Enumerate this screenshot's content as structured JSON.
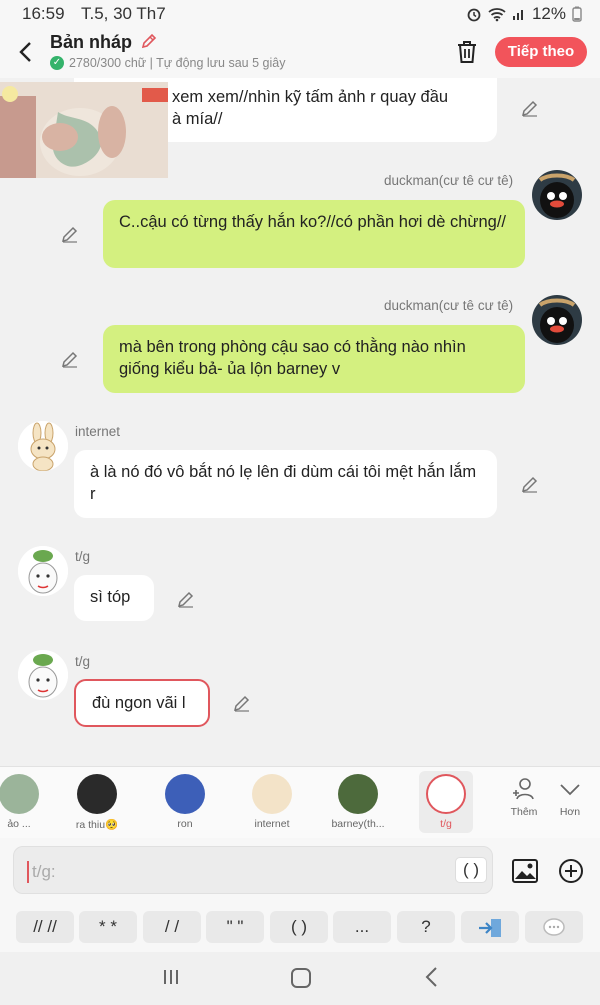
{
  "status": {
    "time": "16:59",
    "date": "T.5, 30 Th7",
    "battery": "12%"
  },
  "header": {
    "title": "Bản nháp",
    "subtitle": "2780/300 chữ | Tự động lưu sau 5 giây",
    "next_label": "Tiếp theo"
  },
  "messages": [
    {
      "speaker": "",
      "text": "xem xem//nhìn kỹ tấm ảnh r quay đầu\nà mía//",
      "style": "white",
      "side": "left"
    },
    {
      "speaker": "duckman(cư tê cư tê)",
      "text": "C..cậu có từng thấy hắn ko?//có phần hơi dè chừng//",
      "style": "green",
      "side": "right"
    },
    {
      "speaker": "duckman(cư tê cư tê)",
      "text": "mà bên trong phòng cậu sao có thằng nào nhìn giống kiểu bả- ủa lộn barney v",
      "style": "green",
      "side": "right"
    },
    {
      "speaker": "internet",
      "text": "à là nó đó vô bắt nó lẹ lên đi dùm cái tôi mệt hắn lắm r",
      "style": "white",
      "side": "left"
    },
    {
      "speaker": "t/g",
      "text": "sì tóp",
      "style": "white",
      "side": "left"
    },
    {
      "speaker": "t/g",
      "text": "đù ngon vãi l",
      "style": "outlined",
      "side": "left"
    }
  ],
  "characters": [
    {
      "label": "ảo ...",
      "color": "#9bb49a"
    },
    {
      "label": "ra thiu🥺",
      "color": "#2a2a2a"
    },
    {
      "label": "ron",
      "color": "#3d5fb8"
    },
    {
      "label": "internet",
      "color": "#f3e3c8"
    },
    {
      "label": "barney(th...",
      "color": "#4d6a3c"
    },
    {
      "label": "t/g",
      "color": "#ffffff"
    }
  ],
  "character_actions": {
    "add_label": "Thêm",
    "more_label": "Hơn"
  },
  "input": {
    "placeholder": "t/g:",
    "paren_label": "( )"
  },
  "quick_inserts": [
    "// //",
    "* *",
    "/ /",
    "\" \"",
    "( )",
    "...",
    "?"
  ],
  "colors": {
    "accent": "#f2545b",
    "green_bubble": "#d4f080",
    "selected_outline": "#e0575d"
  }
}
